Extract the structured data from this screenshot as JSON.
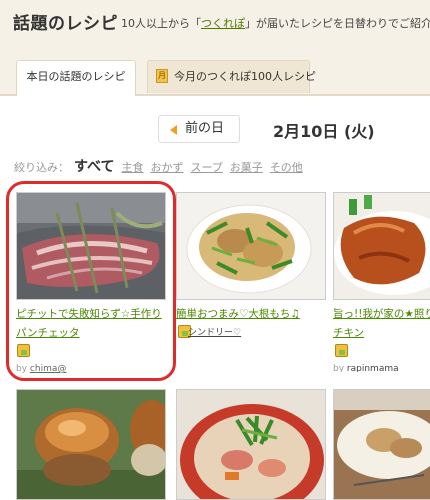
{
  "header": {
    "title": "話題のレシピ",
    "desc_prefix": "10人以上から「",
    "desc_link": "つくれぽ",
    "desc_suffix": "」が届いたレシピを日替わりでご紹介"
  },
  "tabs": [
    {
      "label": "本日の話題のレシピ",
      "active": true
    },
    {
      "label": "今月のつくれぽ100人レシピ",
      "active": false
    }
  ],
  "date_nav": {
    "prev_label": "前の日",
    "current_date": "2月10日 (火)"
  },
  "filters": {
    "label": "絞り込み：",
    "items": [
      {
        "label": "すべて",
        "active": true
      },
      {
        "label": "主食",
        "active": false
      },
      {
        "label": "おかず",
        "active": false
      },
      {
        "label": "スープ",
        "active": false
      },
      {
        "label": "お菓子",
        "active": false
      },
      {
        "label": "その他",
        "active": false
      }
    ]
  },
  "recipes": [
    {
      "title_line1": "ピチットで失敗知らず☆手作り",
      "title_line2": "パンチェッタ",
      "author_prefix": "by",
      "author": "chima@"
    },
    {
      "title_line1": "簡単おつまみ♡大根もち♫",
      "author": "シンドリー♡"
    },
    {
      "title_line1": "旨っ!!我が家の★照り焼きチキン",
      "title_line2": "チキン",
      "author_prefix": "by",
      "author": "rapinmama"
    }
  ],
  "colors": {
    "accent_link": "#4a8a00",
    "highlight": "#e12a2a",
    "header_bg": "#f6f1e6"
  }
}
